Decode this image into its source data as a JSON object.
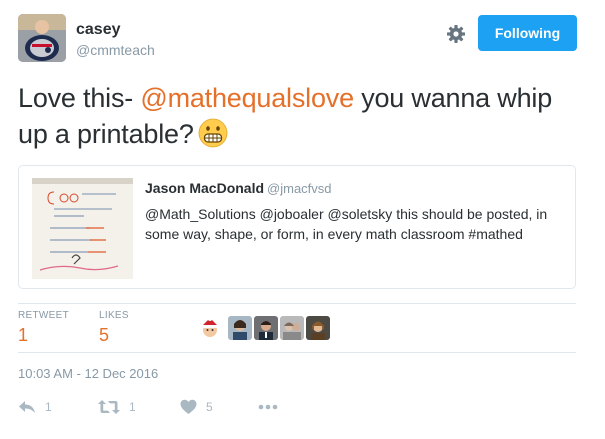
{
  "author": {
    "display_name": "casey",
    "handle": "@cmmteach"
  },
  "follow_label": "Following",
  "tweet": {
    "text_before": "Love this- ",
    "mention": "@mathequalslove",
    "text_after": " you wanna whip up a printable?",
    "emoji": "grimacing-face"
  },
  "quote": {
    "name": "Jason MacDonald",
    "handle": "@jmacfvsd",
    "text": "@Math_Solutions @joboaler @soletsky this should be posted, in some way, shape, or form, in every math classroom #mathed"
  },
  "stats": {
    "retweet_label": "RETWEET",
    "retweet_count": "1",
    "likes_label": "LIKES",
    "likes_count": "5"
  },
  "timestamp": "10:03 AM - 12 Dec 2016",
  "actions": {
    "reply_count": "1",
    "retweet_count": "1",
    "like_count": "5"
  },
  "colors": {
    "accent": "#e4702a",
    "follow_button": "#1da1f2",
    "muted": "#8899a6",
    "icon": "#aab8c2"
  },
  "icons": [
    "gear-icon",
    "reply-icon",
    "retweet-icon",
    "heart-icon",
    "more-icon"
  ]
}
